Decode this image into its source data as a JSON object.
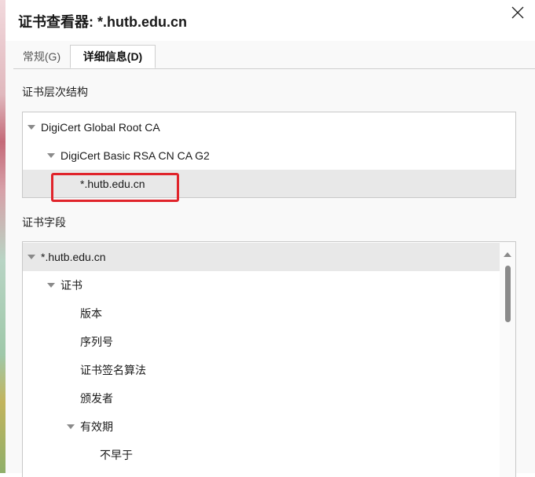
{
  "window": {
    "title": "证书查看器: *.hutb.edu.cn",
    "close_icon": "close-icon"
  },
  "tabs": [
    {
      "label": "常规(G)",
      "selected": false
    },
    {
      "label": "详细信息(D)",
      "selected": true
    }
  ],
  "hierarchy": {
    "label": "证书层次结构",
    "items": [
      {
        "label": "DigiCert Global Root CA",
        "level": 0,
        "expanded": true
      },
      {
        "label": "DigiCert Basic RSA CN CA G2",
        "level": 1,
        "expanded": true
      },
      {
        "label": "*.hutb.edu.cn",
        "level": 2,
        "selected": true
      }
    ]
  },
  "fields": {
    "label": "证书字段",
    "items": [
      {
        "label": "*.hutb.edu.cn",
        "level": 0,
        "expanded": true,
        "selected": true
      },
      {
        "label": "证书",
        "level": 1,
        "expanded": true
      },
      {
        "label": "版本",
        "level": 2
      },
      {
        "label": "序列号",
        "level": 2
      },
      {
        "label": "证书签名算法",
        "level": 2
      },
      {
        "label": "颁发者",
        "level": 2
      },
      {
        "label": "有效期",
        "level": 2,
        "expanded": true
      },
      {
        "label": "不早于",
        "level": 3
      }
    ]
  },
  "colors": {
    "highlight_annotation": "#e0242b",
    "selected_row": "#e8e8e8"
  }
}
